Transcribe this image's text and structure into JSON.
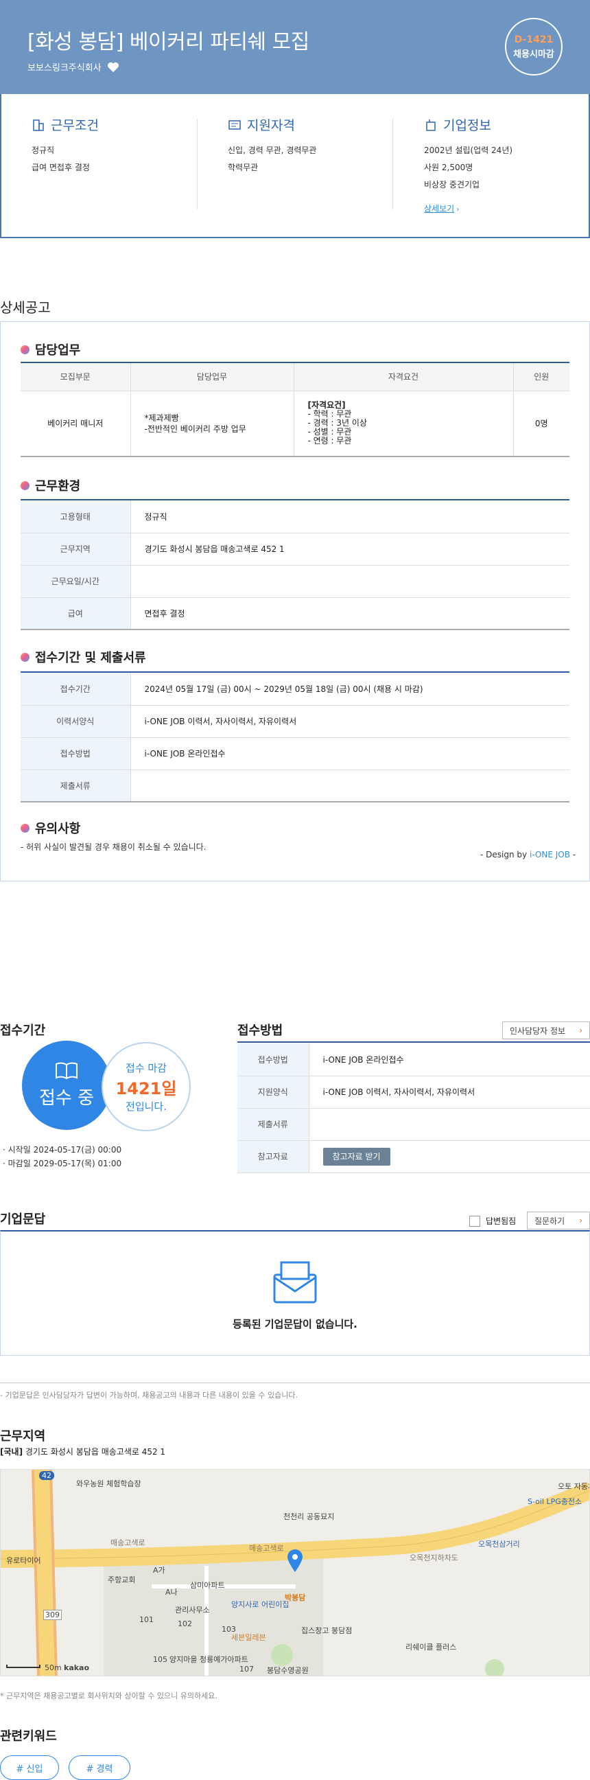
{
  "header": {
    "title": "[화성 봉담] 베이커리 파티쉐 모집",
    "company": "보보스링크주식회사",
    "dday": "D-1421",
    "dday_status": "채용시마감"
  },
  "summary": {
    "work": {
      "title": "근무조건",
      "lines": [
        "정규직",
        "급여 면접후 결정"
      ]
    },
    "qual": {
      "title": "지원자격",
      "lines": [
        "신입, 경력 무관, 경력무관",
        "학력무관"
      ]
    },
    "company": {
      "title": "기업정보",
      "lines": [
        "2002년 설립(업력 24년)",
        "사원 2,500명",
        "비상장 중견기업"
      ],
      "more": "상세보기"
    }
  },
  "detail": {
    "section_title": "상세공고",
    "duty": {
      "title": "담당업무",
      "headers": [
        "모집부문",
        "담당업무",
        "자격요건",
        "인원"
      ],
      "row": {
        "dept": "베이커리 매니저",
        "task": [
          "*제과제빵",
          "-전반적인 베이커리 주방 업무"
        ],
        "req": [
          "[자격요건]",
          "- 학력 : 무관",
          "- 경력 : 3년 이상",
          "- 성별 : 무관",
          "- 연령 : 무관"
        ],
        "count": "0명"
      }
    },
    "env": {
      "title": "근무환경",
      "rows": [
        {
          "k": "고용형태",
          "v": "정규직"
        },
        {
          "k": "근무지역",
          "v": "경기도 화성시 봉담읍 매송고색로 452 1"
        },
        {
          "k": "근무요일/시간",
          "v": ""
        },
        {
          "k": "급여",
          "v": "면접후 결정"
        }
      ]
    },
    "period": {
      "title": "접수기간 및 제출서류",
      "rows": [
        {
          "k": "접수기간",
          "v": "2024년 05월 17일 (금) 00시 ~ 2029년 05월 18일 (금) 00시 (채용 시 마감)"
        },
        {
          "k": "이력서양식",
          "v": "i-ONE JOB 이력서, 자사이력서, 자유이력서"
        },
        {
          "k": "접수방법",
          "v": "i-ONE JOB 온라인접수"
        },
        {
          "k": "제출서류",
          "v": ""
        }
      ]
    },
    "caution": {
      "title": "유의사항",
      "text": "- 허위 사실이 발견될 경우 채용이 취소될 수 있습니다."
    },
    "design": {
      "prefix": "- Design by ",
      "brand": "i-ONE JOB",
      "suffix": " -"
    }
  },
  "apply": {
    "period_title": "접수기간",
    "status": "접수 중",
    "deadline_label": "접수 마감",
    "days": "1421일",
    "days_suffix": "전입니다.",
    "start": "시작일 2024-05-17(금) 00:00",
    "end": "마감일 2029-05-17(목) 01:00",
    "method_title": "접수방법",
    "hr_button": "인사담당자 정보",
    "rows": [
      {
        "k": "접수방법",
        "v": "i-ONE JOB 온라인접수"
      },
      {
        "k": "지원양식",
        "v": "i-ONE JOB 이력서, 자사이력서, 자유이력서"
      },
      {
        "k": "제출서류",
        "v": ""
      },
      {
        "k": "참고자료",
        "v": "참고자료 받기"
      }
    ]
  },
  "qna": {
    "title": "기업문답",
    "answered_only": "답변됨짐",
    "ask_button": "질문하기",
    "empty": "등록된 기업문답이 없습니다.",
    "note": "- 기업문답은 인사담당자가 답변이 가능하며, 채용공고의 내용과 다른 내용이 있을 수 있습니다."
  },
  "location": {
    "title": "근무지역",
    "tag": "[국내]",
    "address": "경기도 화성시 봉담읍 매송고색로 452 1",
    "note": "* 근무지역은 채용공고별로 회사위치와 상이할 수 있으니 유의하세요.",
    "map": {
      "labels": [
        "와우농원 체험학습장",
        "천천리 공동묘지",
        "S-oil LPG충전소",
        "오토 자동차",
        "유로타이어",
        "매송고색로",
        "매송고색로",
        "오목천지하차도",
        "오목천삼거리",
        "주항교회",
        "삼미아파트",
        "관리사무소",
        "양지사로 어린이집",
        "박봉담",
        "집스창고 봉담점",
        "세븐일레븐",
        "양지마을 청룡예가아파트",
        "봉담수영공원",
        "리쉐이클 플러스",
        "A가",
        "A나",
        "101",
        "102",
        "103",
        "105",
        "107",
        "309",
        "50m",
        "kakao",
        "42"
      ]
    }
  },
  "keywords": {
    "title": "관련키워드",
    "items": [
      "# 신입",
      "# 경력"
    ]
  },
  "colors": {
    "header": "#6f95c3",
    "accent": "#2f66b4",
    "orange": "#ef6a2a"
  }
}
